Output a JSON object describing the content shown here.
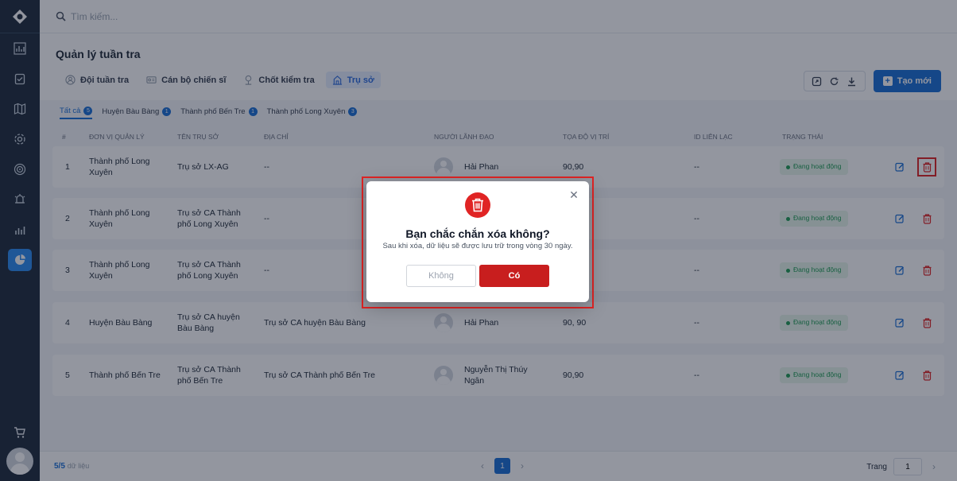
{
  "search": {
    "placeholder": "Tìm kiếm..."
  },
  "page": {
    "title": "Quản lý tuần tra"
  },
  "tabs": [
    {
      "label": "Đội tuần tra",
      "icon": "users-icon"
    },
    {
      "label": "Cán bộ chiến sĩ",
      "icon": "id-card-icon"
    },
    {
      "label": "Chốt kiểm tra",
      "icon": "checkpoint-icon"
    },
    {
      "label": "Trụ sở",
      "icon": "building-icon",
      "active": true
    }
  ],
  "toolbar": {
    "create_label": "Tạo mới"
  },
  "filters": [
    {
      "label": "Tất cả",
      "count": "5",
      "active": true
    },
    {
      "label": "Huyện Bàu Bàng",
      "count": "1"
    },
    {
      "label": "Thành phố Bến Tre",
      "count": "1"
    },
    {
      "label": "Thành phố Long Xuyên",
      "count": "3"
    }
  ],
  "table": {
    "headers": [
      "#",
      "ĐƠN VỊ QUẢN LÝ",
      "TÊN TRỤ SỞ",
      "ĐỊA CHỈ",
      "NGƯỜI LÃNH ĐẠO",
      "TỌA ĐỘ VỊ TRÍ",
      "ID LIÊN LẠC",
      "TRẠNG THÁI"
    ],
    "rows": [
      {
        "no": "1",
        "unit": "Thành phố Long Xuyên",
        "name": "Trụ sở LX-AG",
        "address": "--",
        "leader": "Hải Phan",
        "coords": "90,90",
        "contact": "--",
        "status": "Đang hoạt động"
      },
      {
        "no": "2",
        "unit": "Thành phố Long Xuyên",
        "name": "Trụ sở CA Thành phố Long Xuyên",
        "address": "--",
        "leader": "",
        "coords": "",
        "contact": "--",
        "status": "Đang hoạt động"
      },
      {
        "no": "3",
        "unit": "Thành phố Long Xuyên",
        "name": "Trụ sở CA Thành phố Long Xuyên",
        "address": "--",
        "leader": "",
        "coords": "",
        "contact": "--",
        "status": "Đang hoạt động"
      },
      {
        "no": "4",
        "unit": "Huyện Bàu Bàng",
        "name": "Trụ sở CA huyện Bàu Bàng",
        "address": "Trụ sở CA huyện Bàu Bàng",
        "leader": "Hải Phan",
        "coords": "90, 90",
        "contact": "--",
        "status": "Đang hoạt động"
      },
      {
        "no": "5",
        "unit": "Thành phố Bến Tre",
        "name": "Trụ sở CA Thành phố Bến Tre",
        "address": "Trụ sở CA Thành phố Bến Tre",
        "leader": "Nguyễn Thị Thúy Ngân",
        "coords": "90,90",
        "contact": "--",
        "status": "Đang hoạt động"
      }
    ]
  },
  "footer": {
    "count": "5/5",
    "count_suffix": "dữ liệu",
    "current_page": "1",
    "page_label": "Trang",
    "page_input": "1"
  },
  "modal": {
    "title": "Bạn chắc chắn xóa không?",
    "description": "Sau khi xóa, dữ liệu sẽ được lưu trữ trong vòng 30 ngày.",
    "cancel_label": "Không",
    "confirm_label": "Có"
  },
  "colors": {
    "primary": "#1a6fd6",
    "danger": "#e02424",
    "sidebar": "#1f2d3d",
    "success": "#1f9d55"
  }
}
